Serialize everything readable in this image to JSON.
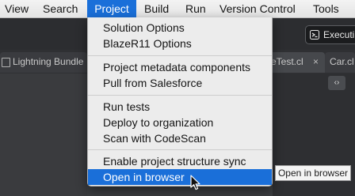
{
  "menubar": {
    "items": [
      {
        "label": "View"
      },
      {
        "label": "Search"
      },
      {
        "label": "Project"
      },
      {
        "label": "Build"
      },
      {
        "label": "Run"
      },
      {
        "label": "Version Control"
      },
      {
        "label": "Tools"
      }
    ],
    "active_item": "Project"
  },
  "toolbar": {
    "execute_label": "Executi",
    "execute_icon": "execute-icon"
  },
  "tabs": {
    "items": [
      {
        "label": "Lightning Bundle"
      },
      {
        "label": "eTest.cl"
      },
      {
        "label": "Car.cl"
      }
    ],
    "close_glyph": "×"
  },
  "editor": {
    "nav_glyph": "‹›"
  },
  "project_menu": {
    "groups": [
      [
        "Solution Options",
        "BlazeR11 Options"
      ],
      [
        "Project metadata components",
        "Pull from Salesforce"
      ],
      [
        "Run tests",
        "Deploy to organization",
        "Scan with CodeScan"
      ],
      [
        "Enable project structure sync",
        "Open in browser"
      ]
    ],
    "highlighted_item": "Open in browser"
  },
  "tooltip": {
    "text": "Open in browser"
  },
  "colors": {
    "accent": "#1a6fd9",
    "menu_bg": "#ececec",
    "ide_bg": "#2c2d30"
  }
}
